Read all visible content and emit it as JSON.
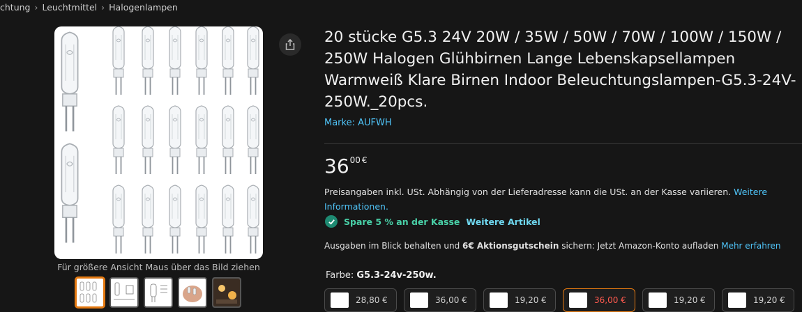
{
  "breadcrumb": {
    "items": [
      "chtung",
      "Leuchtmittel",
      "Halogenlampen"
    ]
  },
  "product": {
    "title": "20 stücke G5.3 24V 20W / 35W / 50W / 70W / 100W / 150W / 250W Halogen Glühbirnen Lange Lebenskapsellampen Warmweiß Klare Birnen Indoor Beleuchtungslampen-G5.3-24V-250W._20pcs.",
    "brand": "Marke: AUFWH"
  },
  "price": {
    "whole": "36",
    "fraction": "00",
    "currency": "€"
  },
  "tax": {
    "text": "Preisangaben inkl. USt. Abhängig von der Lieferadresse kann die USt. an der Kasse variieren. ",
    "link": "Weitere Informationen."
  },
  "savings": {
    "text": "Spare 5 % an der Kasse",
    "link": "Weitere Artikel"
  },
  "promo": {
    "before": "Ausgaben im Blick behalten und ",
    "bold": "6€ Aktionsgutschein",
    "after": " sichern: Jetzt Amazon-Konto aufladen ",
    "link": "Mehr erfahren"
  },
  "gallery": {
    "zoom_hint": "Für größere Ansicht Maus über das Bild ziehen",
    "selected_thumbnail": 0
  },
  "color": {
    "label": "Farbe: ",
    "value": "G5.3-24v-250w."
  },
  "variants": [
    {
      "price": "28,80 €"
    },
    {
      "price": "36,00 €"
    },
    {
      "price": "19,20 €"
    },
    {
      "price": "36,00 €",
      "selected": true
    },
    {
      "price": "19,20 €"
    },
    {
      "price": "19,20 €"
    }
  ],
  "icons": {
    "share": "share-icon",
    "check": "check-icon"
  },
  "colors": {
    "link": "#4fc3f7",
    "accent": "#e47911",
    "savings": "#49d1a8"
  }
}
